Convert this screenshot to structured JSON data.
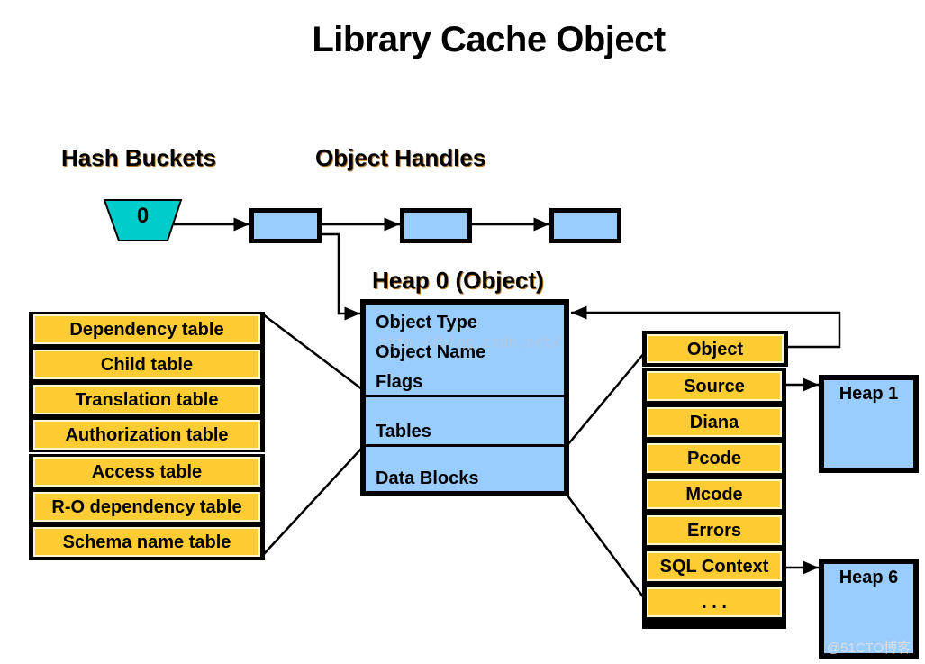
{
  "title": "Library Cache Object",
  "headers": {
    "hash_buckets": "Hash Buckets",
    "object_handles": "Object Handles",
    "heap0": "Heap 0 (Object)"
  },
  "hash_bucket_value": "0",
  "heap0_sections": {
    "header_fields": [
      "Object Type",
      "Object Name",
      "Flags"
    ],
    "tables": "Tables",
    "data_blocks": "Data Blocks"
  },
  "left_tables": {
    "group1": [
      "Dependency table",
      "Child table",
      "Translation table",
      "Authorization table"
    ],
    "group2": [
      "Access table",
      "R-O dependency table",
      "Schema name table"
    ]
  },
  "right_blocks": {
    "object": "Object",
    "items": [
      "Source",
      "Diana",
      "Pcode",
      "Mcode",
      "Errors",
      "SQL Context",
      ". . ."
    ]
  },
  "heaps": {
    "heap1": "Heap 1",
    "heap6": "Heap 6"
  },
  "watermarks": {
    "center": "http://blog.csdn.net/",
    "corner": "@51CTO博客"
  },
  "colors": {
    "yellow": "#ffcc33",
    "blue": "#99ccff",
    "teal": "#00cccc"
  }
}
